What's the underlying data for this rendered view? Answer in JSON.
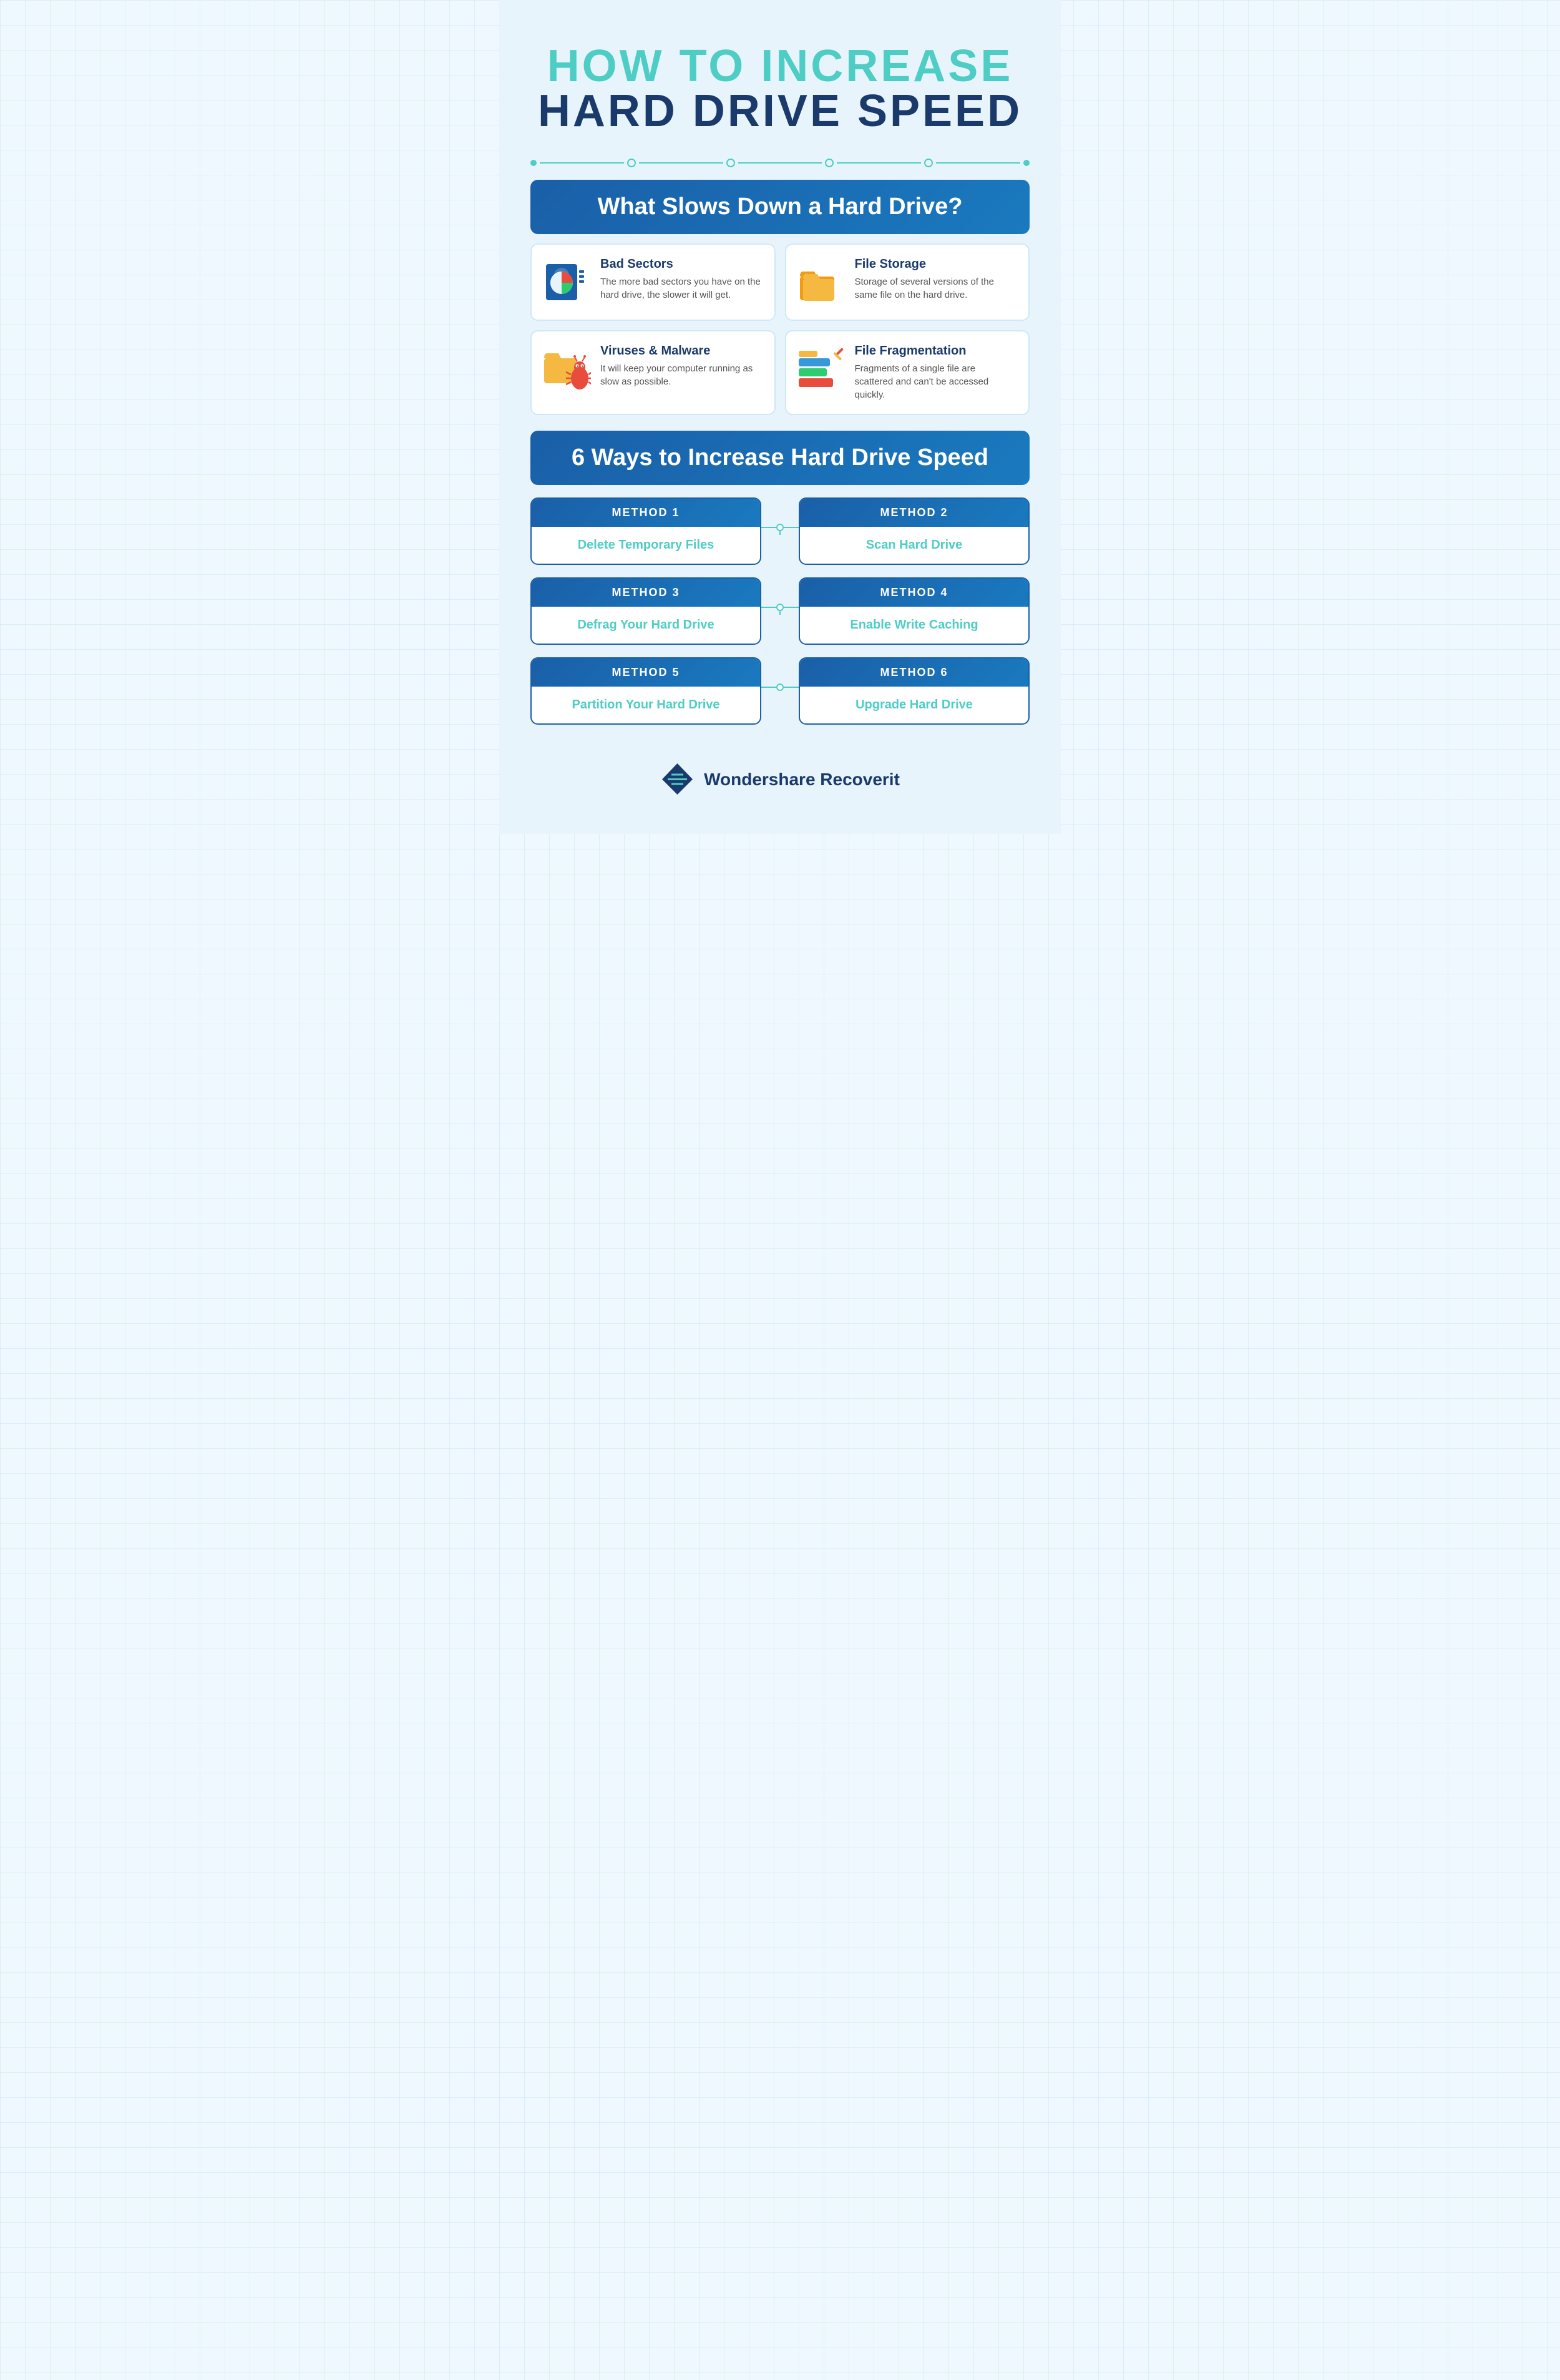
{
  "header": {
    "title_line1": "HOW TO  INCREASE",
    "title_line2": "HARD DRIVE SPEED"
  },
  "slows_section": {
    "banner": "What Slows Down a Hard Drive?",
    "cards": [
      {
        "id": "bad-sectors",
        "title": "Bad Sectors",
        "description": "The more bad sectors you have on the hard drive, the slower it will get.",
        "icon": "bad-sectors-icon"
      },
      {
        "id": "file-storage",
        "title": "File Storage",
        "description": "Storage of several versions of the same file on the hard drive.",
        "icon": "file-storage-icon"
      },
      {
        "id": "viruses",
        "title": "Viruses & Malware",
        "description": "It will keep your computer running as slow as possible.",
        "icon": "virus-icon"
      },
      {
        "id": "fragmentation",
        "title": "File Fragmentation",
        "description": "Fragments of a single file are scattered and can't be accessed quickly.",
        "icon": "fragmentation-icon"
      }
    ]
  },
  "ways_section": {
    "banner": "6 Ways to Increase Hard Drive Speed",
    "methods": [
      {
        "number": "METHOD 1",
        "title": "Delete Temporary Files"
      },
      {
        "number": "METHOD 2",
        "title": "Scan Hard Drive"
      },
      {
        "number": "METHOD 3",
        "title": "Defrag Your Hard Drive"
      },
      {
        "number": "METHOD 4",
        "title": "Enable Write Caching"
      },
      {
        "number": "METHOD 5",
        "title": "Partition Your Hard Drive"
      },
      {
        "number": "METHOD 6",
        "title": "Upgrade Hard Drive"
      }
    ]
  },
  "footer": {
    "brand": "Wondershare Recoverit"
  }
}
